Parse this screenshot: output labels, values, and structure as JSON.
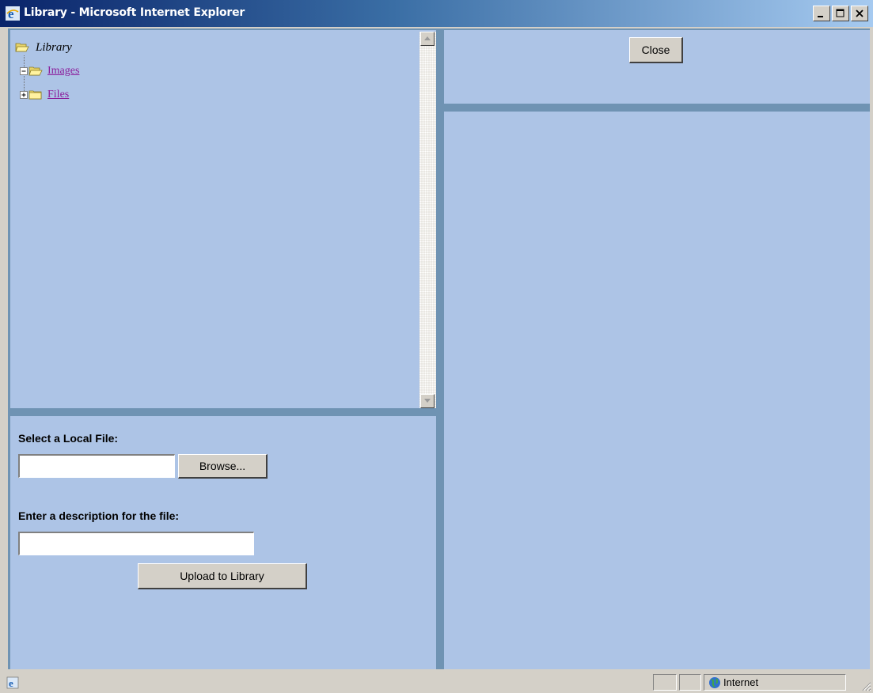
{
  "window": {
    "title": "Library - Microsoft Internet Explorer",
    "controls": [
      "minimize-icon",
      "maximize-icon",
      "close-icon"
    ]
  },
  "tree": {
    "root_label": "Library",
    "items": [
      {
        "label": "Images",
        "expander": "minus",
        "icon": "open-folder-icon"
      },
      {
        "label": "Files",
        "expander": "plus",
        "icon": "folder-icon"
      }
    ]
  },
  "upload": {
    "local_file_label": "Select a Local File:",
    "file_path_value": "",
    "browse_label": "Browse...",
    "description_label": "Enter a description for the file:",
    "description_value": "",
    "submit_label": "Upload to Library"
  },
  "toolbar": {
    "close_label": "Close"
  },
  "status": {
    "zone_label": "Internet"
  },
  "colors": {
    "frame_bg": "#adc4e6",
    "frame_divider": "#6f93b3",
    "link": "#8b1d9b"
  }
}
